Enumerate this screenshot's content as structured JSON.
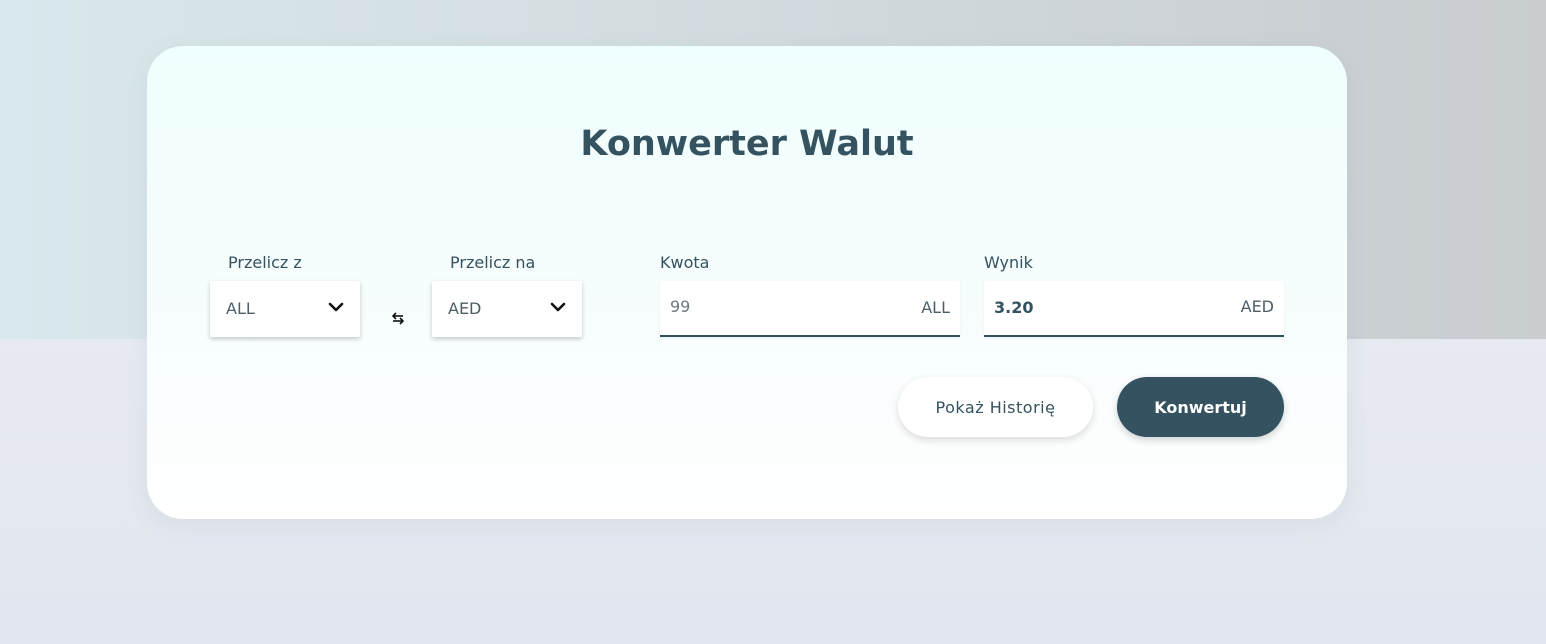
{
  "app": {
    "title": "Konwerter Walut"
  },
  "converter": {
    "from": {
      "label": "Przelicz z",
      "selected": "ALL"
    },
    "to": {
      "label": "Przelicz na",
      "selected": "AED"
    },
    "amount": {
      "label": "Kwota",
      "value": "99",
      "unit": "ALL"
    },
    "result": {
      "label": "Wynik",
      "value": "3.20",
      "unit": "AED"
    }
  },
  "actions": {
    "history_label": "Pokaż Historię",
    "convert_label": "Konwertuj"
  },
  "icons": {
    "swap": "swap-arrows-icon",
    "dropdown": "chevron-down-icon"
  },
  "colors": {
    "primary": "#34525f",
    "card_background": "#f3fefe",
    "page_background": "#e4e8ef"
  }
}
